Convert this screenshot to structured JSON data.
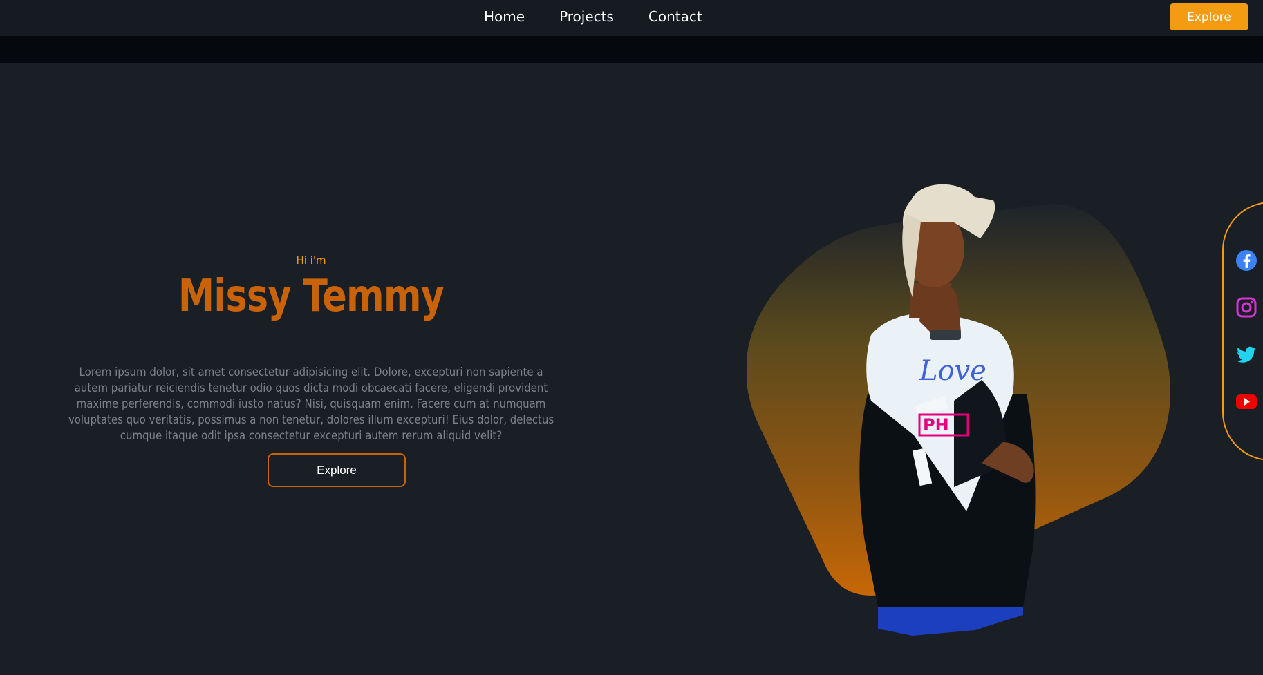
{
  "nav": {
    "links": [
      "Home",
      "Projects",
      "Contact"
    ],
    "button_label": "Explore"
  },
  "hero": {
    "greeting": "Hi i'm",
    "name": "Missy Temmy",
    "description": "Lorem ipsum dolor, sit amet consectetur adipisicing elit. Dolore, excepturi non sapiente a autem pariatur reiciendis tenetur odio quos dicta modi obcaecati facere, eligendi provident maxime perferendis, commodi iusto natus? Nisi, quisquam enim. Facere cum at numquam voluptates quo veritatis, possimus a non tenetur, dolores illum excepturi! Eius dolor, delectus cumque itaque odit ipsa consectetur excepturi autem rerum aliquid velit?",
    "button_label": "Explore",
    "portrait_shirt_text": [
      "Love",
      "PH"
    ]
  },
  "social": [
    {
      "icon": "facebook-icon",
      "color": "#3b82f6"
    },
    {
      "icon": "instagram-icon",
      "color": "#d433d6"
    },
    {
      "icon": "twitter-icon",
      "color": "#22d3ee"
    },
    {
      "icon": "youtube-icon",
      "color": "#ef0000"
    }
  ],
  "colors": {
    "accent": "#f39c12",
    "name": "#c8630a",
    "background": "#1a1f25",
    "nav": "#161b21"
  }
}
